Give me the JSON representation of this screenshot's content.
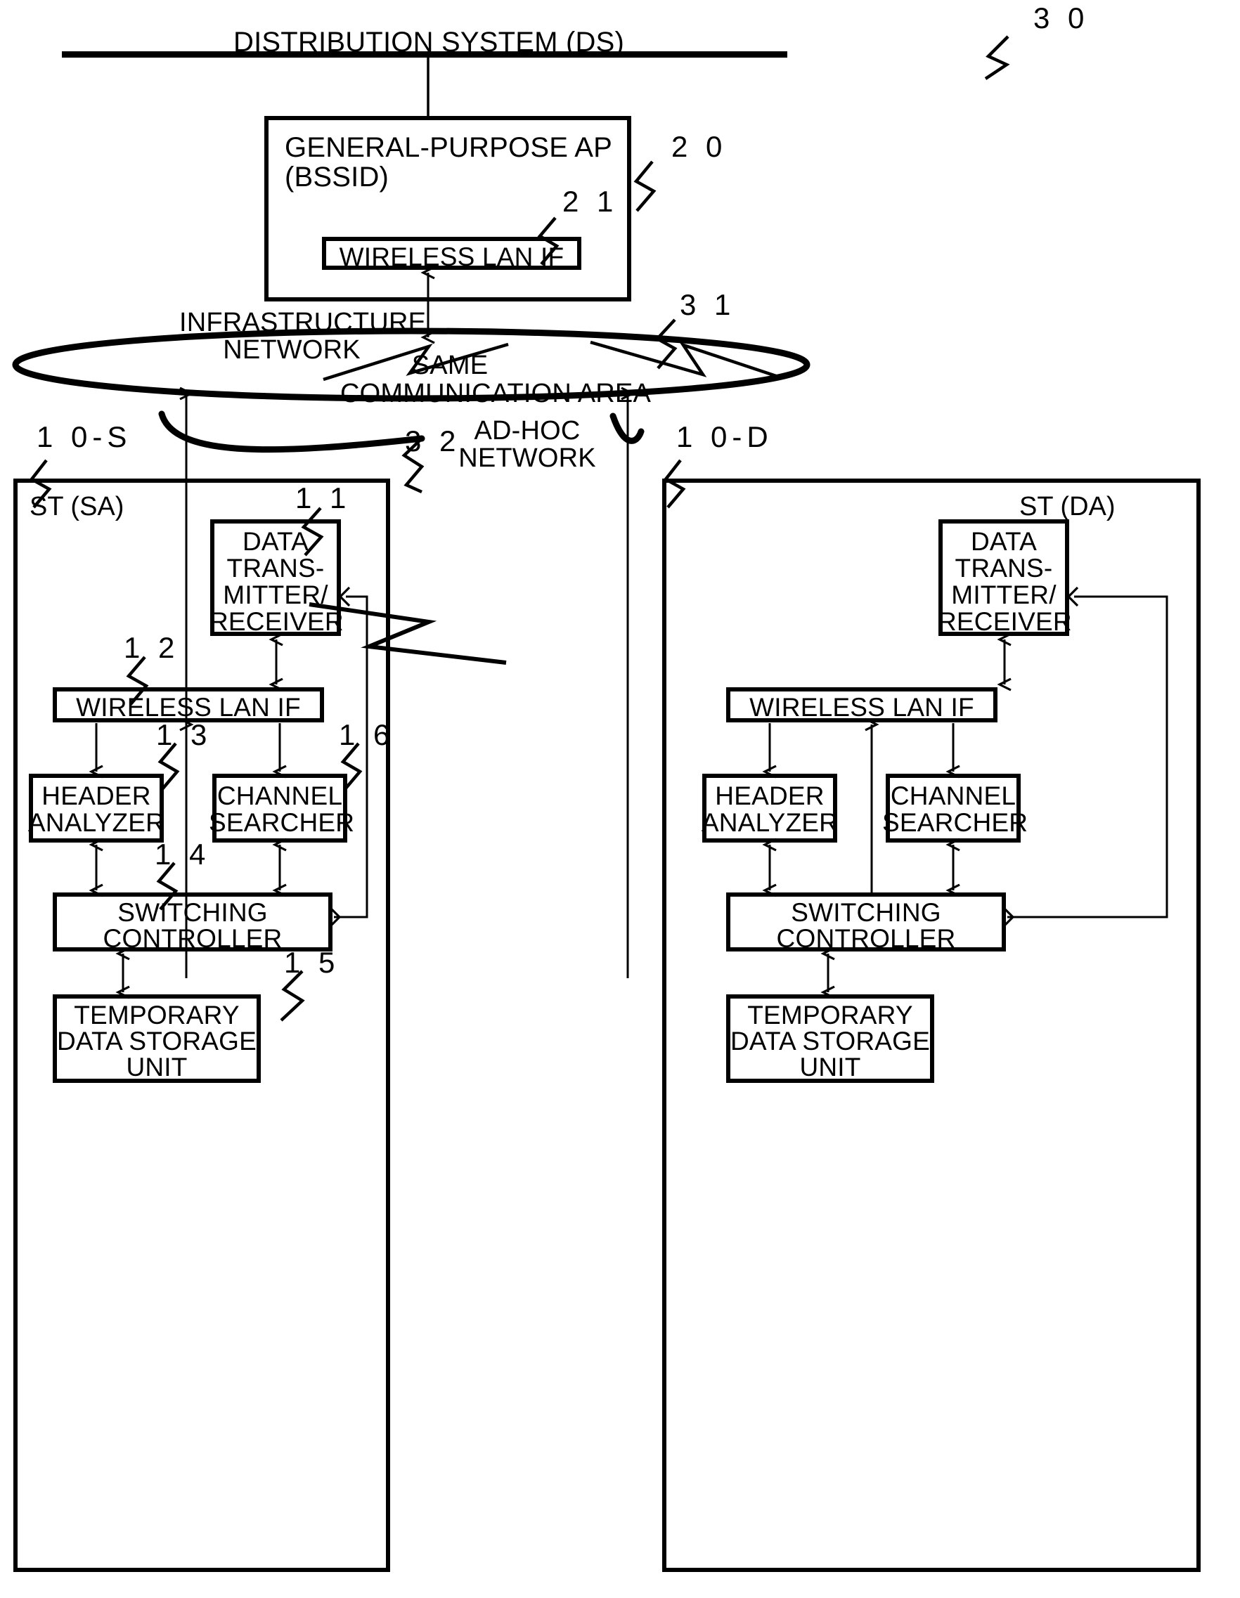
{
  "figure": {
    "type": "patent-block-diagram",
    "title_text": "DISTRIBUTION SYSTEM (DS)"
  },
  "distribution_system": {
    "label": "DISTRIBUTION SYSTEM (DS)",
    "ref": "3 0"
  },
  "access_point": {
    "title_line1": "GENERAL-PURPOSE AP",
    "title_line2": "(BSSID)",
    "ref": "2 0",
    "wireless_lan_if": {
      "label": "WIRELESS LAN IF",
      "ref": "2 1"
    }
  },
  "networks": {
    "infrastructure": {
      "line1": "INFRASTRUCTURE",
      "line2": "NETWORK",
      "ref": "3 1"
    },
    "same_area": {
      "line1": "SAME",
      "line2": "COMMUNICATION AREA"
    },
    "adhoc": {
      "line1": "AD-HOC",
      "line2": "NETWORK",
      "ref": "3 2"
    }
  },
  "stations": [
    {
      "id": "source",
      "name": "ST (SA)",
      "ref": "1 0-S",
      "blocks": {
        "data_txrx": {
          "lines": [
            "DATA",
            "TRANS-",
            "MITTER/",
            "RECEIVER"
          ],
          "ref": "1 1"
        },
        "wireless_lan_if": {
          "label": "WIRELESS LAN IF",
          "ref": "1 2"
        },
        "header_analyzer": {
          "lines": [
            "HEADER",
            "ANALYZER"
          ],
          "ref": "1 3"
        },
        "channel_searcher": {
          "lines": [
            "CHANNEL",
            "SEARCHER"
          ],
          "ref": "1 6"
        },
        "switching_controller": {
          "lines": [
            "SWITCHING",
            "CONTROLLER"
          ],
          "ref": "1 4"
        },
        "temp_data_storage": {
          "lines": [
            "TEMPORARY",
            "DATA STORAGE",
            "UNIT"
          ],
          "ref": "1 5"
        }
      }
    },
    {
      "id": "destination",
      "name": "ST (DA)",
      "ref": "1 0-D",
      "blocks": {
        "data_txrx": {
          "lines": [
            "DATA",
            "TRANS-",
            "MITTER/",
            "RECEIVER"
          ],
          "ref": ""
        },
        "wireless_lan_if": {
          "label": "WIRELESS LAN IF",
          "ref": ""
        },
        "header_analyzer": {
          "lines": [
            "HEADER",
            "ANALYZER"
          ],
          "ref": ""
        },
        "channel_searcher": {
          "lines": [
            "CHANNEL",
            "SEARCHER"
          ],
          "ref": ""
        },
        "switching_controller": {
          "lines": [
            "SWITCHING",
            "CONTROLLER"
          ],
          "ref": ""
        },
        "temp_data_storage": {
          "lines": [
            "TEMPORARY",
            "DATA STORAGE",
            "UNIT"
          ],
          "ref": ""
        }
      }
    }
  ],
  "colors": {
    "ink": "#000000",
    "paper": "#ffffff"
  }
}
